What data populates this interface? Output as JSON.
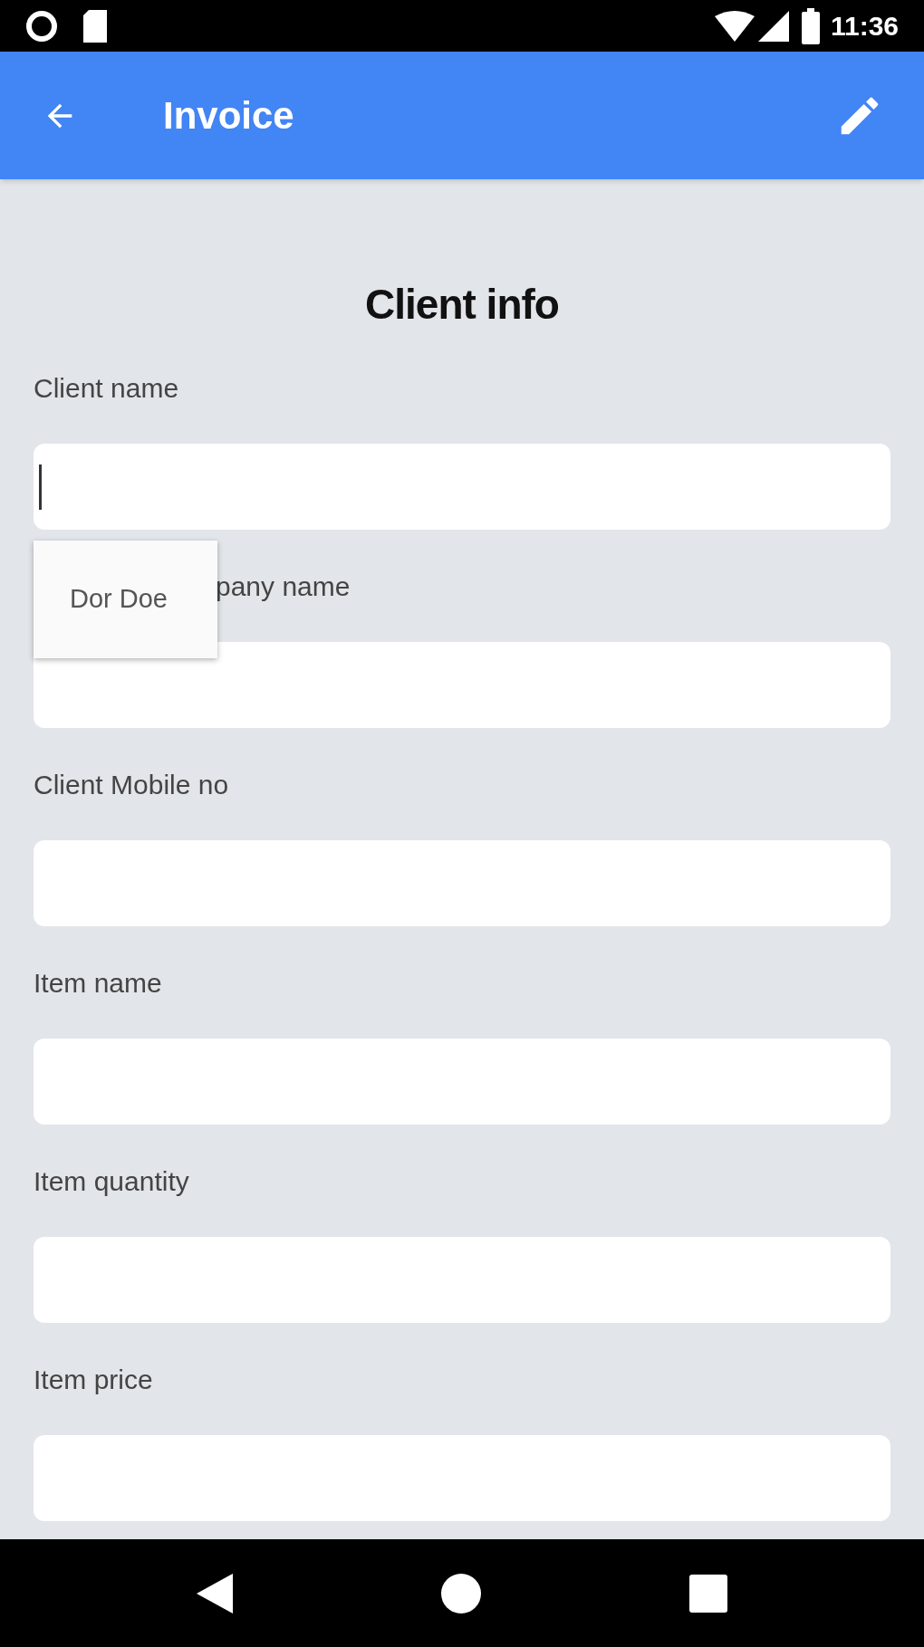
{
  "status_bar": {
    "time": "11:36"
  },
  "app_bar": {
    "title": "Invoice"
  },
  "form": {
    "heading": "Client info",
    "fields": [
      {
        "label": "Client name",
        "focused": true
      },
      {
        "label": "pany name",
        "focused": false
      },
      {
        "label": "Client Mobile no",
        "focused": false
      },
      {
        "label": "Item name",
        "focused": false
      },
      {
        "label": "Item quantity",
        "focused": false
      },
      {
        "label": "Item price",
        "focused": false
      }
    ]
  },
  "suggestion_popup": {
    "items": [
      "Dor Doe"
    ]
  }
}
